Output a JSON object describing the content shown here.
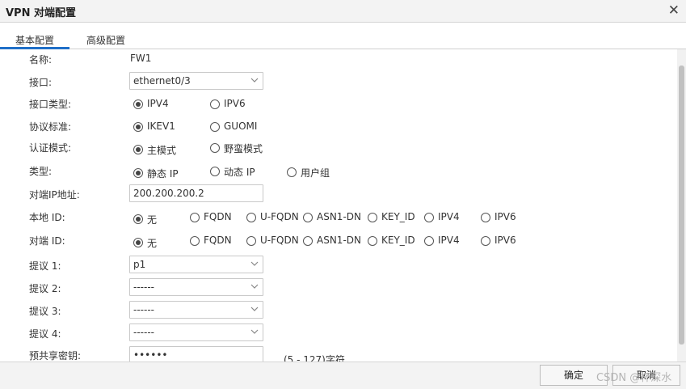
{
  "dialog": {
    "title": "VPN 对端配置"
  },
  "tabs": [
    {
      "label": "基本配置"
    },
    {
      "label": "高级配置"
    }
  ],
  "form": {
    "name": {
      "label": "名称:",
      "value": "FW1"
    },
    "interface": {
      "label": "接口:",
      "value": "ethernet0/3"
    },
    "interface_type": {
      "label": "接口类型:",
      "options": [
        "IPV4",
        "IPV6"
      ],
      "selected": "IPV4"
    },
    "protocol": {
      "label": "协议标准:",
      "options": [
        "IKEV1",
        "GUOMI"
      ],
      "selected": "IKEV1"
    },
    "auth_mode": {
      "label": "认证模式:",
      "options": [
        "主模式",
        "野蛮模式"
      ],
      "selected": "主模式"
    },
    "type": {
      "label": "类型:",
      "options": [
        "静态 IP",
        "动态 IP",
        "用户组"
      ],
      "selected": "静态 IP"
    },
    "peer_ip": {
      "label": "对端IP地址:",
      "value": "200.200.200.2"
    },
    "local_id": {
      "label": "本地 ID:",
      "options": [
        "无",
        "FQDN",
        "U-FQDN",
        "ASN1-DN",
        "KEY_ID",
        "IPV4",
        "IPV6"
      ],
      "selected": "无"
    },
    "peer_id": {
      "label": "对端 ID:",
      "options": [
        "无",
        "FQDN",
        "U-FQDN",
        "ASN1-DN",
        "KEY_ID",
        "IPV4",
        "IPV6"
      ],
      "selected": "无"
    },
    "proposal1": {
      "label": "提议 1:",
      "value": "p1"
    },
    "proposal2": {
      "label": "提议 2:",
      "value": "------"
    },
    "proposal3": {
      "label": "提议 3:",
      "value": "------"
    },
    "proposal4": {
      "label": "提议 4:",
      "value": "------"
    },
    "psk": {
      "label": "预共享密钥:",
      "value": "••••••",
      "hint": "(5 - 127)字符"
    }
  },
  "footer": {
    "ok_label": "确定",
    "cancel_label": "取消"
  },
  "watermark": "CSDN @杯深水",
  "colors": {
    "accent": "#1f6fc8"
  }
}
